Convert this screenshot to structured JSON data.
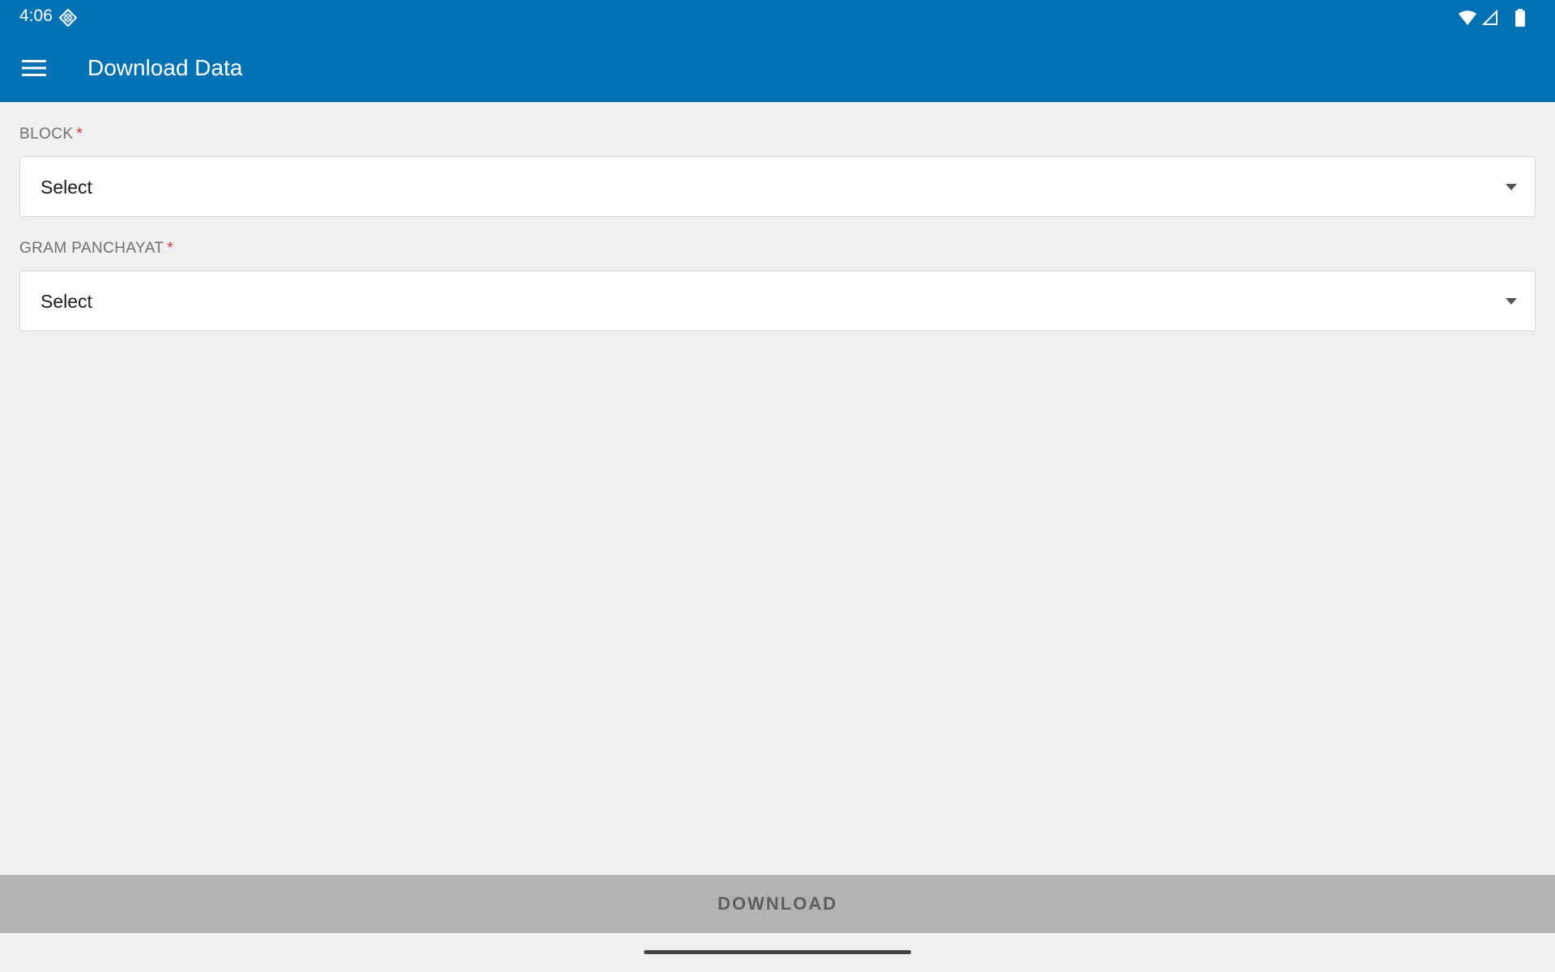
{
  "status_bar": {
    "time": "4:06",
    "app_icon": "diamond-grid-icon",
    "icons": [
      "wifi-icon",
      "signal-icon",
      "battery-icon"
    ]
  },
  "app_bar": {
    "menu_icon": "menu-icon",
    "title": "Download Data",
    "background_color": "#0072b4"
  },
  "form": {
    "block": {
      "label": "BLOCK",
      "required_mark": "*",
      "value": "Select",
      "caret_icon": "chevron-down-icon"
    },
    "gram_panchayat": {
      "label": "GRAM PANCHAYAT",
      "required_mark": "*",
      "value": "Select",
      "caret_icon": "chevron-down-icon"
    }
  },
  "download_button": {
    "label": "DOWNLOAD",
    "background_color": "#b3b3b3"
  }
}
